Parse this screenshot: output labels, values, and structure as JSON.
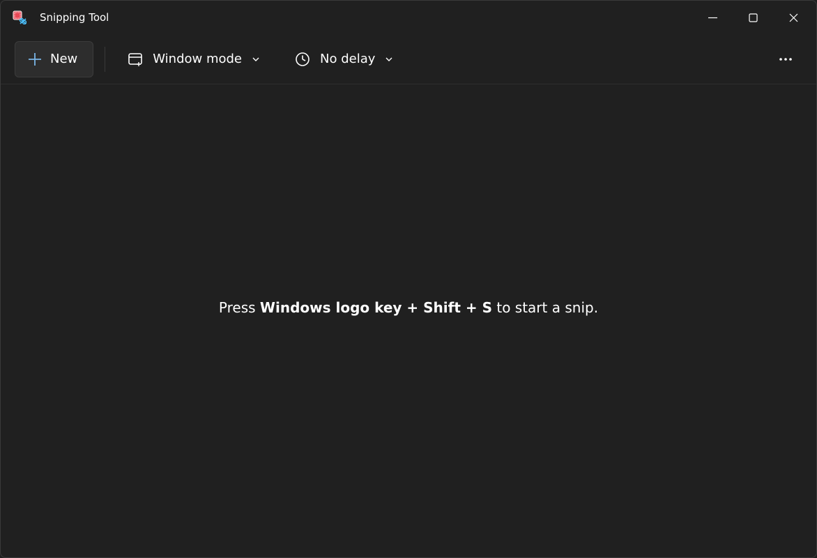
{
  "window": {
    "title": "Snipping Tool"
  },
  "toolbar": {
    "new_label": "New",
    "mode_label": "Window mode",
    "delay_label": "No delay"
  },
  "content": {
    "hint_prefix": "Press ",
    "hint_shortcut": "Windows logo key + Shift + S",
    "hint_suffix": " to start a snip."
  }
}
